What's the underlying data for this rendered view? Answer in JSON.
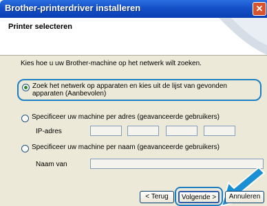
{
  "window": {
    "title": "Brother-printerdriver installeren",
    "close_glyph": "✕"
  },
  "header": {
    "title": "Printer selecteren"
  },
  "content": {
    "prompt": "Kies hoe u uw Brother-machine op het netwerk wilt zoeken.",
    "option_search": "Zoek het netwerk op apparaten en kies uit de lijst van gevonden apparaten (Aanbevolen)",
    "option_address": "Specificeer uw machine per adres (geavanceerde gebruikers)",
    "ip_label": "IP-adres",
    "option_name": "Specificeer uw machine per naam (geavanceerde gebruikers)",
    "name_label": "Naam van"
  },
  "buttons": {
    "back": "< Terug",
    "next": "Volgende >",
    "cancel": "Annuleren"
  },
  "colors": {
    "titlebar": "#1450c8",
    "highlight": "#1a7fc2",
    "arrow": "#1a8fd4"
  }
}
